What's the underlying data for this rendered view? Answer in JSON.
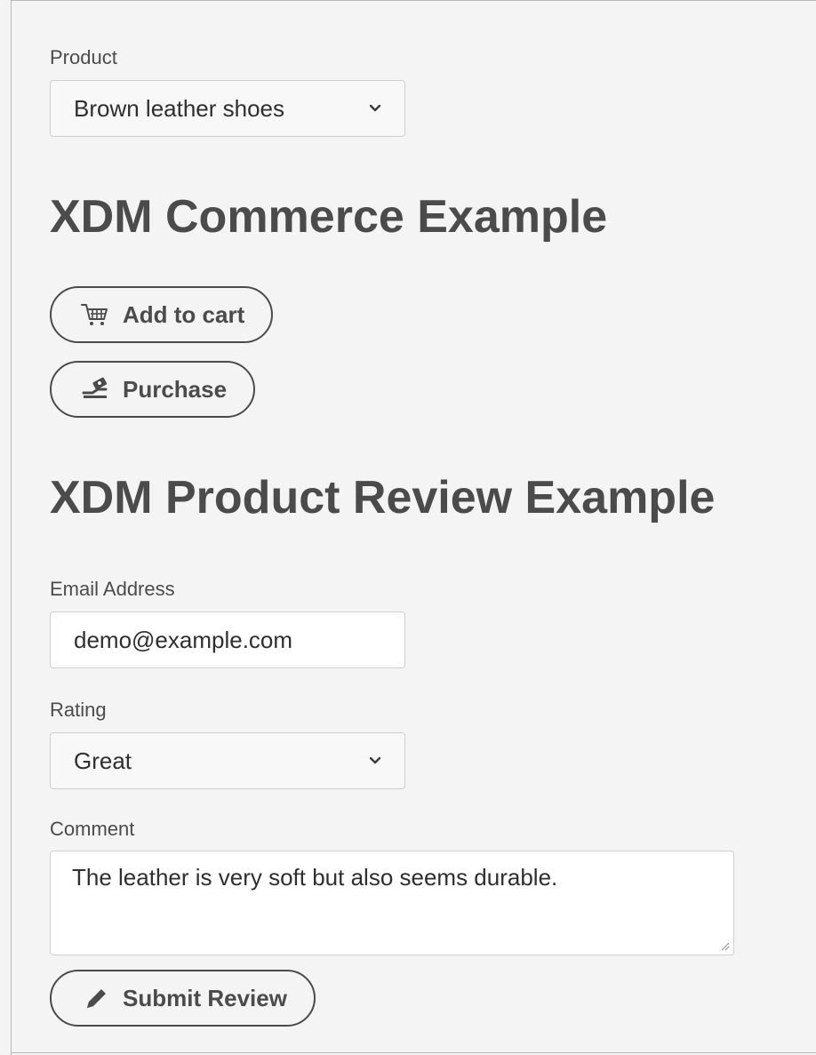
{
  "product": {
    "label": "Product",
    "selected": "Brown leather shoes"
  },
  "commerce": {
    "heading": "XDM Commerce Example",
    "add_to_cart_label": "Add to cart",
    "purchase_label": "Purchase"
  },
  "review": {
    "heading": "XDM Product Review Example",
    "email_label": "Email Address",
    "email_value": "demo@example.com",
    "rating_label": "Rating",
    "rating_selected": "Great",
    "comment_label": "Comment",
    "comment_value": "The leather is very soft but also seems durable.",
    "submit_label": "Submit Review"
  },
  "icons": {
    "select_chevron": "chevron-down-icon",
    "add_to_cart": "cart-icon",
    "purchase": "hand-holding-money-icon",
    "submit": "pencil-icon",
    "resize": "resize-grip-icon"
  },
  "colors": {
    "background": "#f4f4f4",
    "text": "#4b4b4b",
    "border": "#cfcfcf"
  }
}
